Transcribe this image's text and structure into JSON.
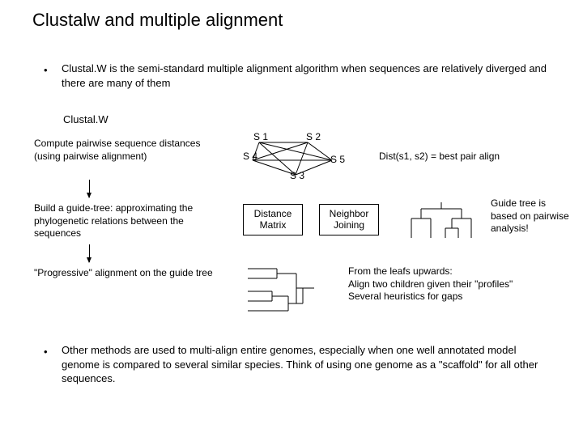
{
  "title": "Clustalw and multiple alignment",
  "bullet1": "Clustal.W is the semi-standard multiple alignment algorithm when sequences are relatively diverged and there are many of them",
  "subhead": "Clustal.W",
  "step1": "Compute pairwise sequence distances (using pairwise alignment)",
  "step2": "Build a guide-tree: approximating the phylogenetic relations between the sequences",
  "step3": "\"Progressive\" alignment on the guide tree",
  "graph": {
    "s1": "S 1",
    "s2": "S 2",
    "s3": "S 3",
    "s4": "S 4",
    "s5": "S 5"
  },
  "dist_eq": "Dist(s1, s2) = best pair align",
  "box1": "Distance Matrix",
  "box2": "Neighbor Joining",
  "guide_note": "Guide tree is based on pairwise analysis!",
  "progressive_note": "From the leafs upwards:\nAlign two children given their \"profiles\"\nSeveral heuristics for gaps",
  "bullet2": "Other methods are used to multi-align entire genomes, especially when one well annotated model genome is compared to several similar species. Think of using one genome as a \"scaffold\" for all other sequences."
}
